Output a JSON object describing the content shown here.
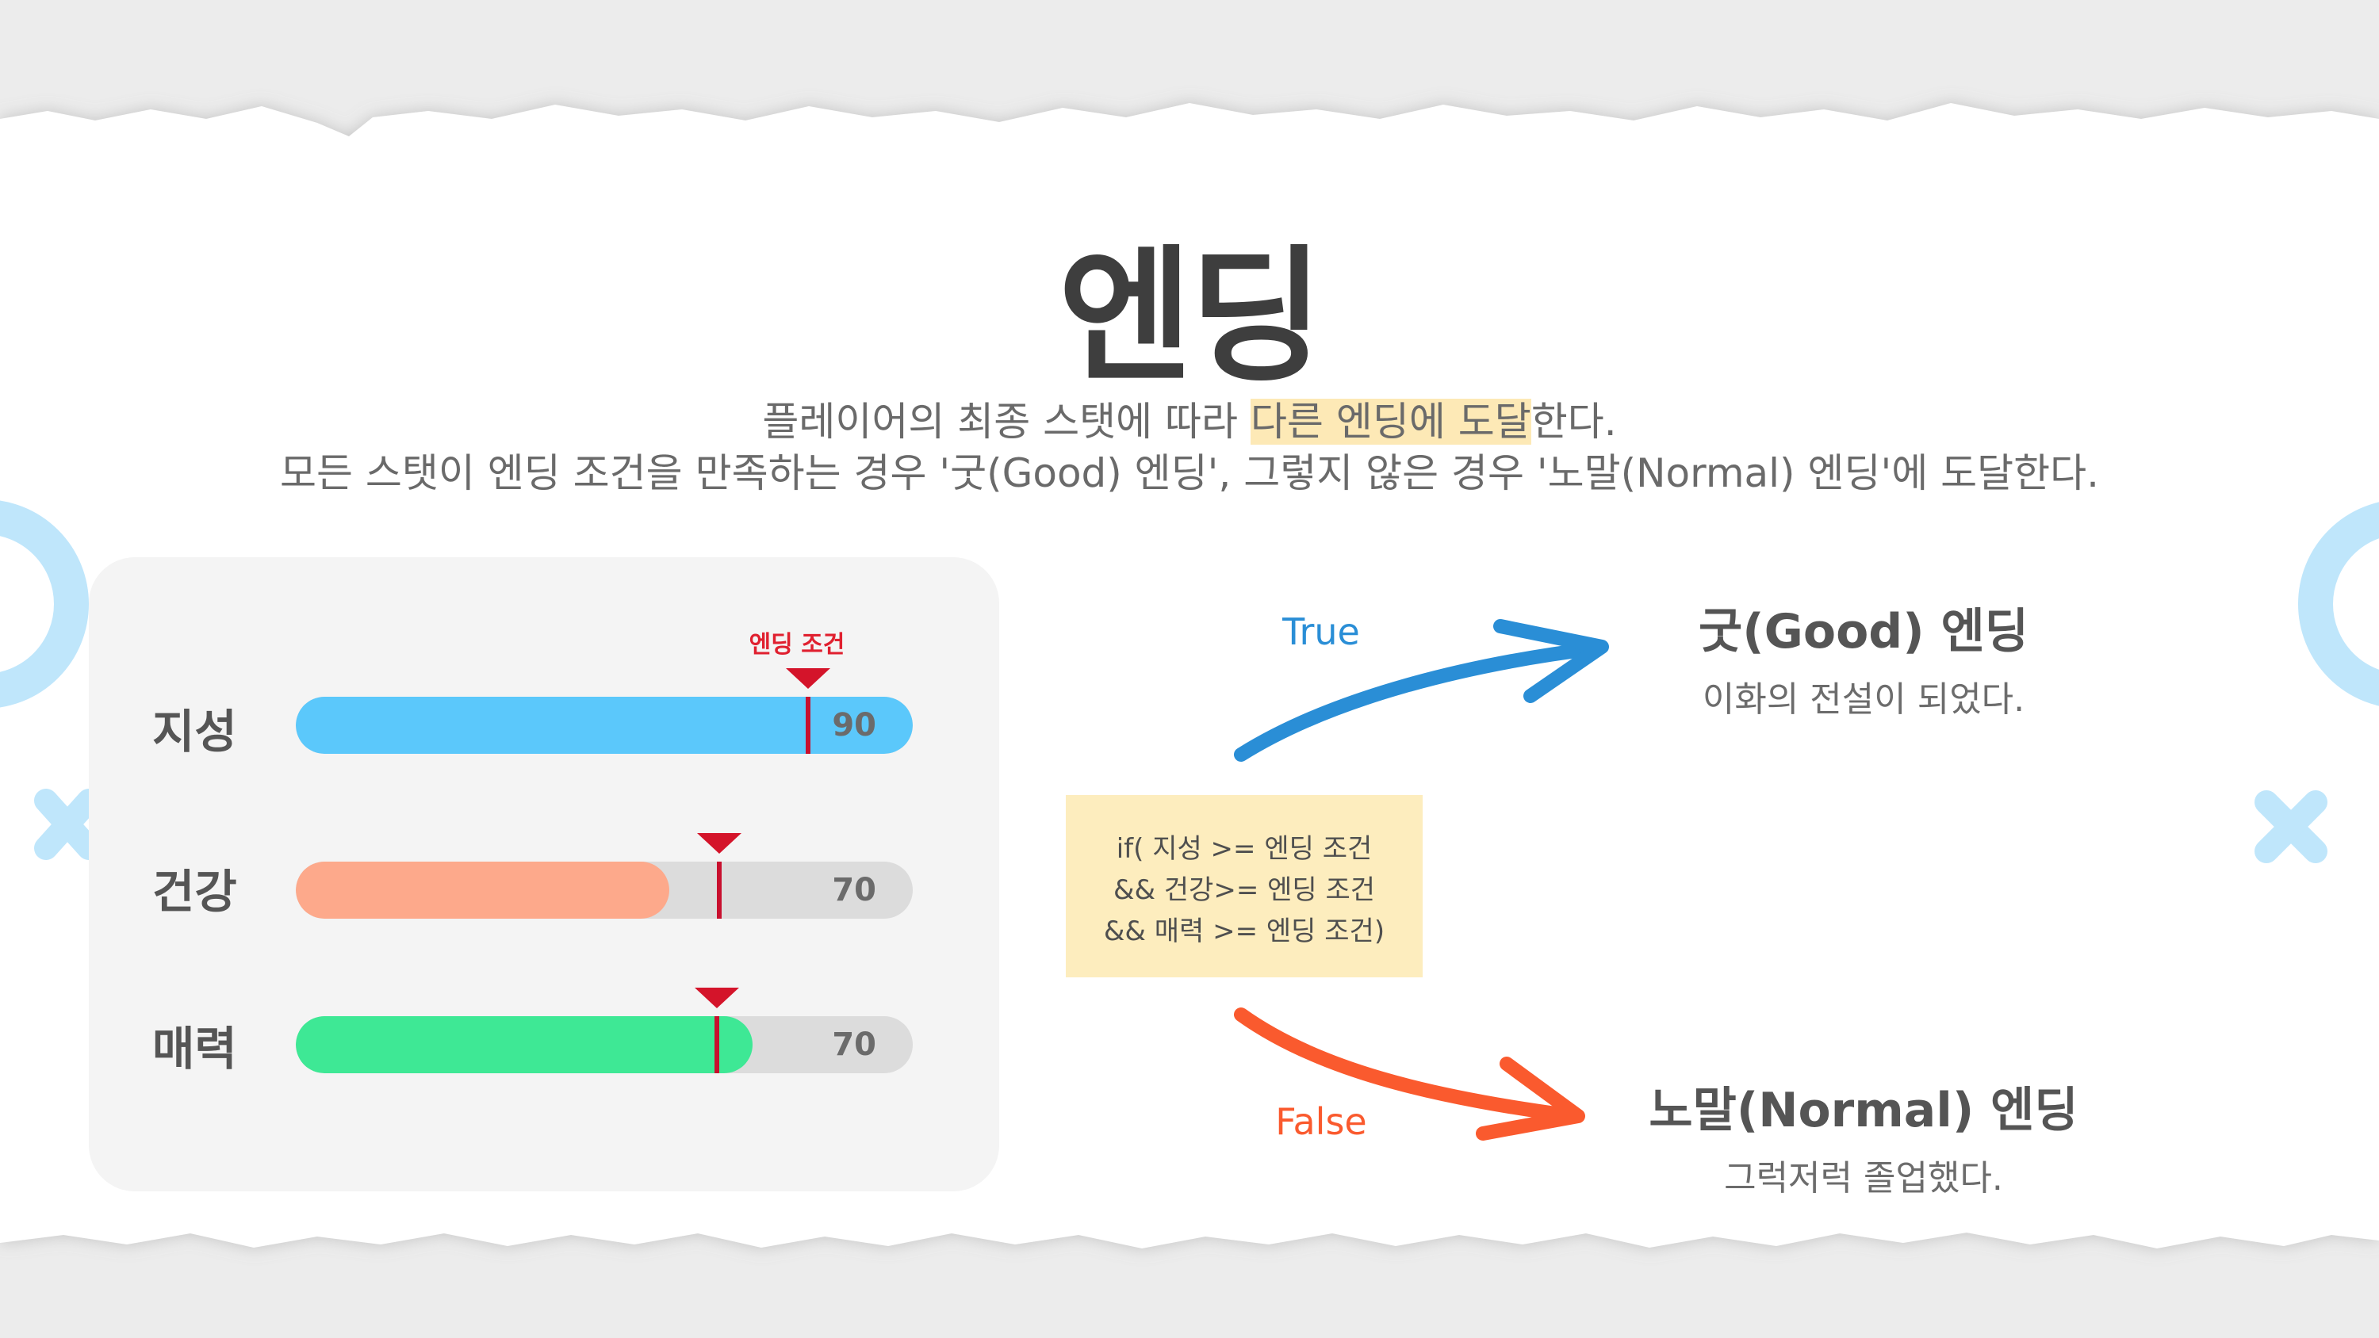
{
  "title": "엔딩",
  "description": {
    "line1_pre": "플레이어의 최종 스탯에 따라 ",
    "line1_highlight": "다른 엔딩에 도달",
    "line1_post": "한다.",
    "line2": "모든 스탯이 엔딩 조건을 만족하는 경우 '굿(Good) 엔딩', 그렇지 않은 경우 '노말(Normal) 엔딩'에 도달한다."
  },
  "stats_panel": {
    "condition_label": "엔딩 조건",
    "stats": [
      {
        "label": "지성",
        "value_text": "90",
        "fill_fraction": 1.0,
        "threshold_fraction": 0.83,
        "color": "#5bc8fb"
      },
      {
        "label": "건강",
        "value_text": "70",
        "fill_fraction": 0.605,
        "threshold_fraction": 0.687,
        "color": "#fda98b"
      },
      {
        "label": "매력",
        "value_text": "70",
        "fill_fraction": 0.74,
        "threshold_fraction": 0.683,
        "color": "#3ee895"
      }
    ]
  },
  "condition": {
    "lines": [
      "if( 지성 >= 엔딩 조건",
      "&& 건강>= 엔딩 조건",
      "&& 매력 >= 엔딩 조건)"
    ]
  },
  "branches": {
    "true_label": "True",
    "false_label": "False",
    "true_color": "#2a8ed6",
    "false_color": "#fa5a2e"
  },
  "endings": {
    "good": {
      "title": "굿(Good) 엔딩",
      "desc": "이화의 전설이 되었다."
    },
    "normal": {
      "title": "노말(Normal) 엔딩",
      "desc": "그럭저럭 졸업했다."
    }
  },
  "decor": {
    "accent": "#bfe6fb"
  }
}
